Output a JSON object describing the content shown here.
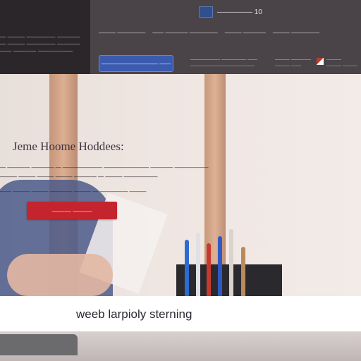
{
  "header": {
    "left_lines": [
      "— ——— ————— ————",
      "— ——— ————— ————",
      "—— ———— ——————"
    ],
    "brand_name": "————— 10",
    "nav_items": [
      "——— —————",
      "—— ———— —————",
      "——— ————",
      "——— —————"
    ],
    "cta_label": "—————————— ——",
    "info_blocks": [
      [
        "—————— ————— ——",
        "—————————————"
      ],
      [
        "——— ————",
        "——— ——"
      ],
      [
        "———",
        "——— ———"
      ]
    ]
  },
  "hero": {
    "title": "Jeme Hoome Hoddees:",
    "subtitle_lines": [
      "— ———— ———— — ——————— ———————— ———— ——————",
      "——— ——— ——— ——— ———— — ——— ——————",
      "—— ——— ——— ———— ——— — ————— ———"
    ],
    "button_label": "——— ———"
  },
  "caption": {
    "text": "weeb larpioly sterning"
  },
  "colors": {
    "header_bg": "#4a4448",
    "accent_blue": "#3b5bb0",
    "accent_red": "#c4242d"
  }
}
